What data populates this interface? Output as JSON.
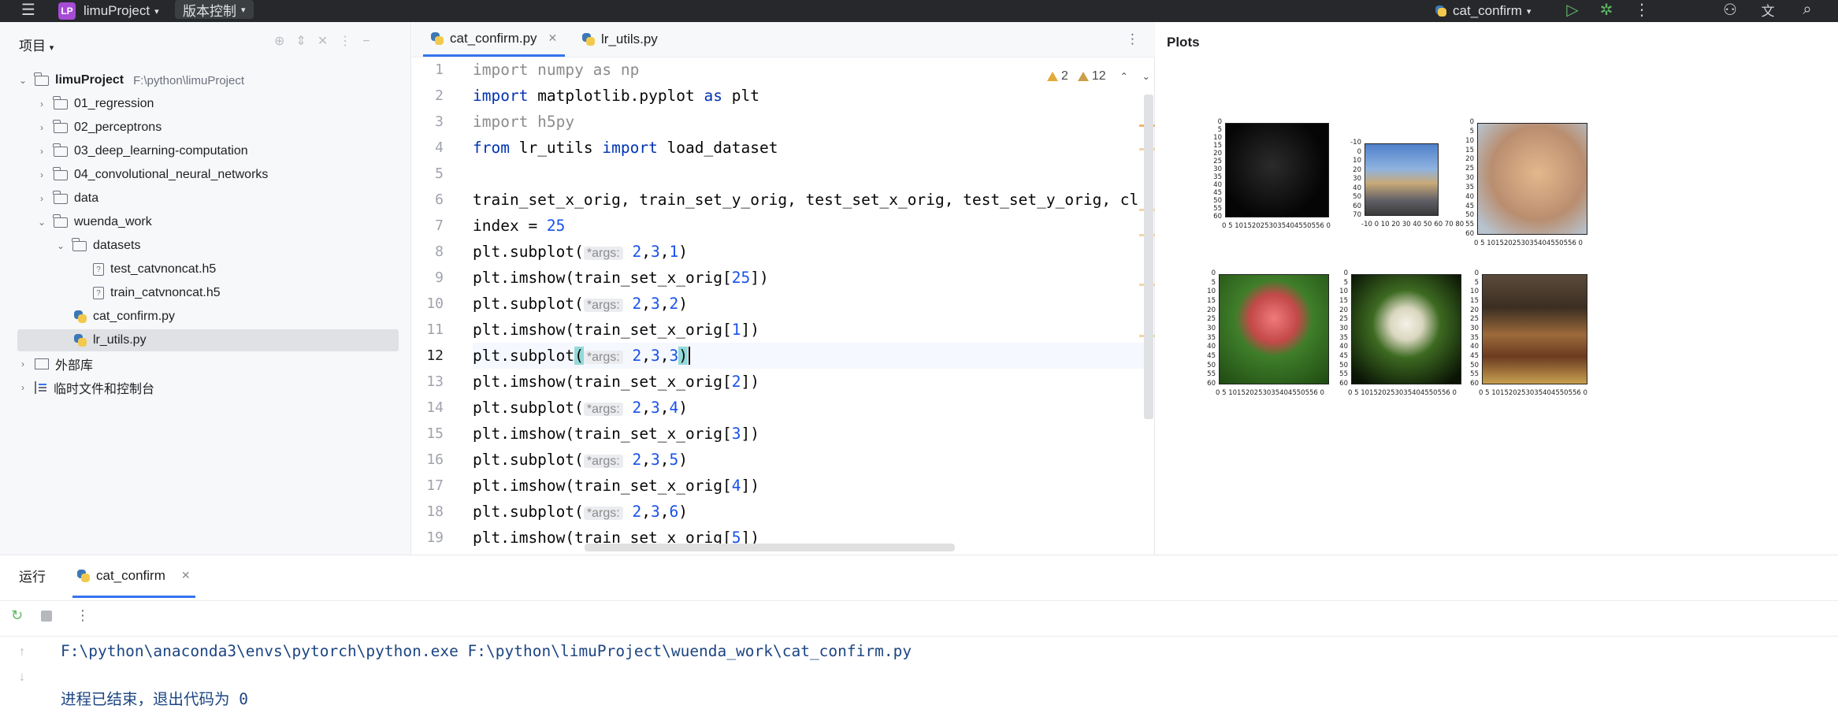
{
  "titlebar": {
    "project_badge": "LP",
    "project_name": "limuProject",
    "vcs_label": "版本控制",
    "run_config": "cat_confirm"
  },
  "project_panel": {
    "title": "项目",
    "root": {
      "name": "limuProject",
      "path": "F:\\python\\limuProject"
    },
    "items": [
      {
        "label": "01_regression"
      },
      {
        "label": "02_perceptrons"
      },
      {
        "label": "03_deep_learning-computation"
      },
      {
        "label": "04_convolutional_neural_networks"
      },
      {
        "label": "data"
      },
      {
        "label": "wuenda_work"
      },
      {
        "label": "datasets"
      },
      {
        "label": "test_catvnoncat.h5"
      },
      {
        "label": "train_catvnoncat.h5"
      },
      {
        "label": "cat_confirm.py"
      },
      {
        "label": "lr_utils.py"
      },
      {
        "label": "外部库"
      },
      {
        "label": "临时文件和控制台"
      }
    ]
  },
  "editor": {
    "tabs": [
      {
        "label": "cat_confirm.py"
      },
      {
        "label": "lr_utils.py"
      }
    ],
    "warnings": {
      "a": "2",
      "b": "12"
    },
    "hint_label": "*args:",
    "lines": [
      {
        "n": "1"
      },
      {
        "n": "2"
      },
      {
        "n": "3"
      },
      {
        "n": "4"
      },
      {
        "n": "5"
      },
      {
        "n": "6"
      },
      {
        "n": "7"
      },
      {
        "n": "8"
      },
      {
        "n": "9"
      },
      {
        "n": "10"
      },
      {
        "n": "11"
      },
      {
        "n": "12"
      },
      {
        "n": "13"
      },
      {
        "n": "14"
      },
      {
        "n": "15"
      },
      {
        "n": "16"
      },
      {
        "n": "17"
      },
      {
        "n": "18"
      },
      {
        "n": "19"
      }
    ],
    "code": {
      "l1": "import numpy as np",
      "l2a": "import",
      "l2b": " matplotlib.pyplot ",
      "l2c": "as",
      "l2d": " plt",
      "l3": "import h5py",
      "l4a": "from",
      "l4b": " lr_utils ",
      "l4c": "import",
      "l4d": " load_dataset",
      "l6": "train_set_x_orig, train_set_y_orig, test_set_x_orig, test_set_y_orig, cl",
      "l7a": "index = ",
      "l7b": "25",
      "subplot": "plt.subplot(",
      "imshow": "plt.imshow(train_set_x_orig[",
      "args": [
        "2",
        "3",
        "1",
        "2",
        "3",
        "2",
        "2",
        "3",
        "3",
        "2",
        "3",
        "4",
        "2",
        "3",
        "5",
        "2",
        "3",
        "6"
      ],
      "idx": [
        "25",
        "1",
        "2",
        "3",
        "4",
        "5"
      ],
      "close_paren": ")",
      "close_bracket": "])",
      "comma": ","
    }
  },
  "plots": {
    "title": "Plots",
    "yticks_a": [
      "0",
      "5",
      "10",
      "15",
      "20",
      "25",
      "30",
      "35",
      "40",
      "45",
      "50",
      "55",
      "60"
    ],
    "yticks_b": [
      "-10",
      "0",
      "10",
      "20",
      "30",
      "40",
      "50",
      "60",
      "70"
    ],
    "xticks_a": "0  5 101520253035404550556 0",
    "xticks_b": "-10  0  10  20  30  40  50  60  70  80"
  },
  "run_panel": {
    "title": "运行",
    "tab": "cat_confirm",
    "command": "F:\\python\\anaconda3\\envs\\pytorch\\python.exe F:\\python\\limuProject\\wuenda_work\\cat_confirm.py",
    "status": "进程已结束，退出代码为 0"
  }
}
